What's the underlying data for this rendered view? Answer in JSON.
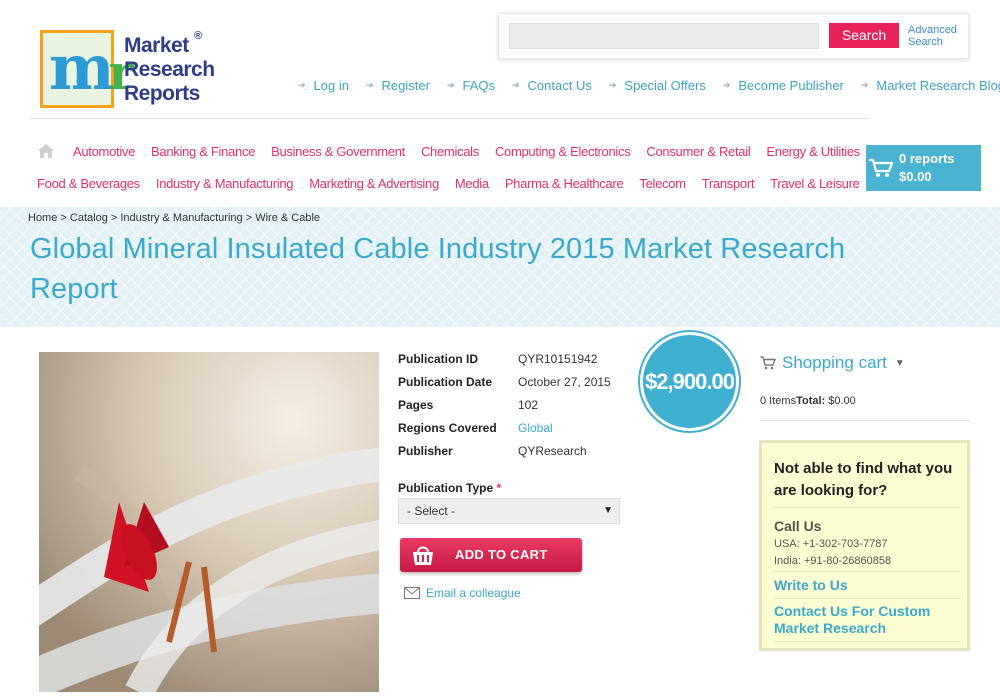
{
  "logo": {
    "letter1": "m",
    "letter2": "r",
    "words": [
      "Market",
      "Research",
      "Reports"
    ],
    "registered": "®"
  },
  "search": {
    "placeholder": "",
    "button": "Search",
    "advanced": "Advanced Search"
  },
  "top_links": [
    "Log in",
    "Register",
    "FAQs",
    "Contact Us",
    "Special Offers",
    "Become Publisher",
    "Market Research Blog"
  ],
  "categories_row1": [
    "Automotive",
    "Banking & Finance",
    "Business & Government",
    "Chemicals",
    "Computing & Electronics",
    "Consumer & Retail",
    "Energy & Utilities"
  ],
  "categories_row2": [
    "Food & Beverages",
    "Industry & Manufacturing",
    "Marketing & Advertising",
    "Media",
    "Pharma & Healthcare",
    "Telecom",
    "Transport",
    "Travel & Leisure"
  ],
  "cart": {
    "count": "0 reports",
    "total": "$0.00"
  },
  "breadcrumb": [
    "Home",
    "Catalog",
    "Industry & Manufacturing",
    "Wire & Cable"
  ],
  "title": "Global Mineral Insulated Cable Industry 2015 Market Research Report",
  "details": [
    {
      "label": "Publication ID",
      "value": "QYR10151942",
      "link": false
    },
    {
      "label": "Publication Date",
      "value": "October 27, 2015",
      "link": false
    },
    {
      "label": "Pages",
      "value": "102",
      "link": false
    },
    {
      "label": "Regions Covered",
      "value": "Global",
      "link": true
    },
    {
      "label": "Publisher",
      "value": "QYResearch",
      "link": false
    }
  ],
  "price": "$2,900.00",
  "publication_type": {
    "label": "Publication Type",
    "required": "*",
    "selected": "- Select -"
  },
  "add_to_cart": "ADD TO CART",
  "email_colleague": "Email a colleague",
  "shopping_cart": {
    "title": "Shopping cart",
    "items": "0 Items",
    "total_label": "Total:",
    "total": "$0.00"
  },
  "help": {
    "title": "Not able to find what you are looking for?",
    "call_us": "Call Us",
    "usa": "USA: +1-302-703-7787",
    "india": "India: +91-80-26860858",
    "write_to_us": "Write to Us",
    "custom": "Contact Us For Custom Market Research"
  },
  "colors": {
    "accent": "#3aa9cc",
    "pink": "#e3306b",
    "cart_blue": "#49b3d1",
    "logo_orange": "#f7a21b"
  }
}
